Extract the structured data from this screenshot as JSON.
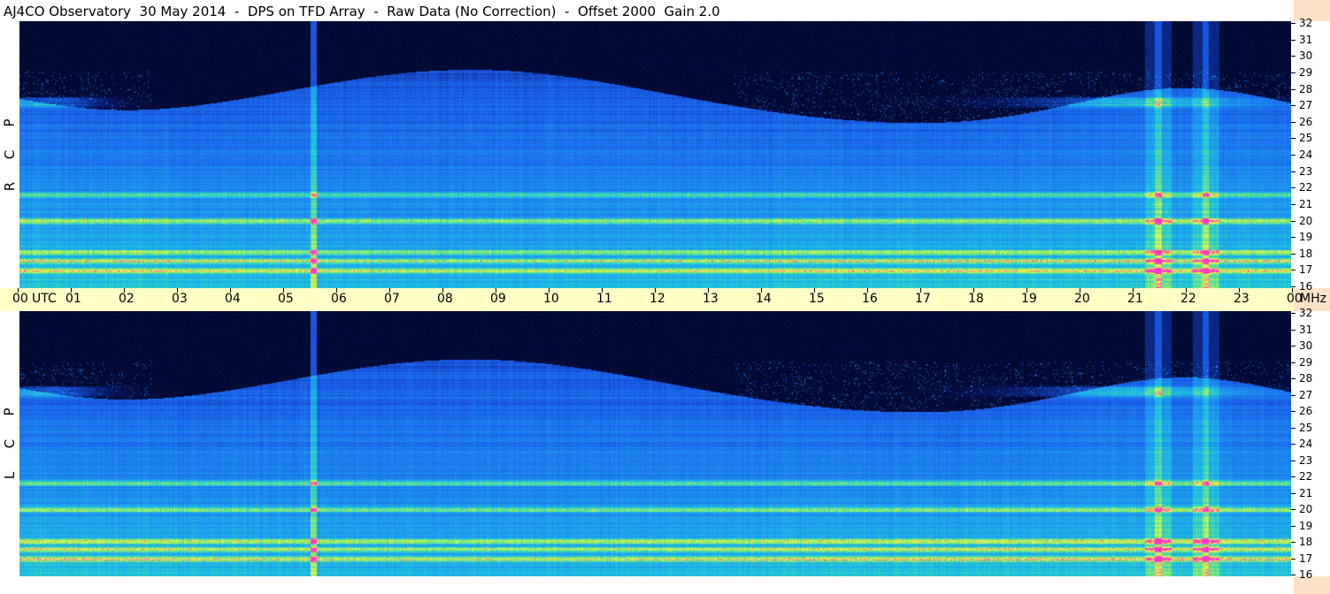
{
  "header": {
    "title": "AJ4CO Observatory  30 May 2014  -  DPS on TFD Array  -  Raw Data (No Correction)  -  Offset 2000  Gain 2.0"
  },
  "panels": {
    "top": {
      "label_letters": [
        "R",
        "C",
        "P"
      ]
    },
    "bottom": {
      "label_letters": [
        "L",
        "C",
        "P"
      ]
    }
  },
  "time_axis": {
    "labels": [
      "00",
      "UTC",
      "01",
      "02",
      "03",
      "04",
      "05",
      "06",
      "07",
      "08",
      "09",
      "10",
      "11",
      "12",
      "13",
      "14",
      "15",
      "16",
      "17",
      "18",
      "19",
      "20",
      "21",
      "22",
      "23",
      "00",
      "MHz"
    ]
  },
  "freq_axis": {
    "labels": [
      "32",
      "31",
      "30",
      "29",
      "28",
      "27",
      "26",
      "25",
      "24",
      "23",
      "22",
      "21",
      "20",
      "19",
      "18",
      "17",
      "16"
    ]
  },
  "colors": {
    "time_band": "#ffffc6",
    "right_band": "#fde2c8",
    "low_intensity": "#000000",
    "mid_intensity": "#1a5ae8",
    "high_intensity": "#f0ff40"
  },
  "chart_data": [
    {
      "type": "heatmap",
      "title": "AJ4CO Observatory  30 May 2014  -  DPS on TFD Array  -  Raw Data (No Correction)  -  Offset 2000  Gain 2.0",
      "panel": "RCP",
      "x_range_utc_hours": [
        0,
        24
      ],
      "y_range_mhz": [
        16,
        32
      ],
      "x_ticks": [
        "00",
        "01",
        "02",
        "03",
        "04",
        "05",
        "06",
        "07",
        "08",
        "09",
        "10",
        "11",
        "12",
        "13",
        "14",
        "15",
        "16",
        "17",
        "18",
        "19",
        "20",
        "21",
        "22",
        "23",
        "00"
      ],
      "y_ticks": [
        16,
        17,
        18,
        19,
        20,
        21,
        22,
        23,
        24,
        25,
        26,
        27,
        28,
        29,
        30,
        31,
        32
      ],
      "xlabel": "UTC",
      "ylabel": "MHz",
      "bright_bands_mhz": [
        17.0,
        17.6,
        18.1,
        20.0,
        21.6,
        27.0,
        27.3
      ],
      "burst_times_utc": [
        5.55,
        21.5,
        22.4
      ]
    },
    {
      "type": "heatmap",
      "panel": "LCP",
      "x_range_utc_hours": [
        0,
        24
      ],
      "y_range_mhz": [
        16,
        32
      ],
      "x_ticks": [
        "00",
        "01",
        "02",
        "03",
        "04",
        "05",
        "06",
        "07",
        "08",
        "09",
        "10",
        "11",
        "12",
        "13",
        "14",
        "15",
        "16",
        "17",
        "18",
        "19",
        "20",
        "21",
        "22",
        "23",
        "00"
      ],
      "y_ticks": [
        16,
        17,
        18,
        19,
        20,
        21,
        22,
        23,
        24,
        25,
        26,
        27,
        28,
        29,
        30,
        31,
        32
      ],
      "xlabel": "UTC",
      "ylabel": "MHz",
      "bright_bands_mhz": [
        17.0,
        17.6,
        18.1,
        20.0,
        21.6,
        27.0,
        27.3
      ],
      "burst_times_utc": [
        5.55,
        21.5,
        22.4
      ]
    }
  ]
}
